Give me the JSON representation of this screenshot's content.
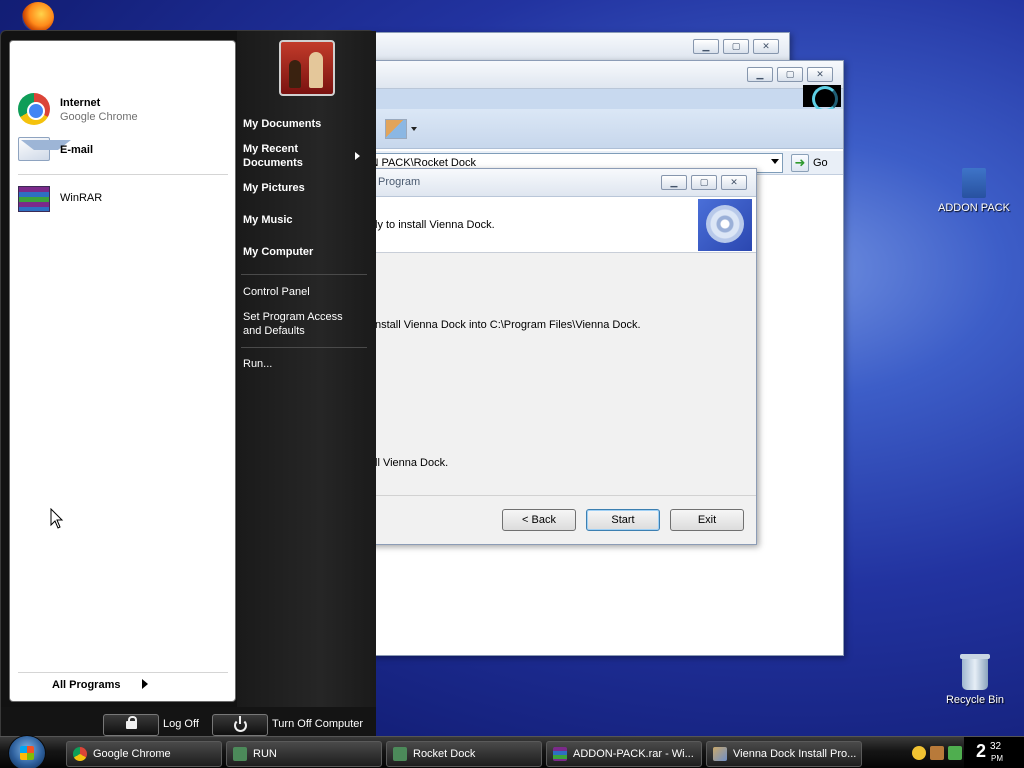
{
  "desktop": {
    "icons": [
      {
        "label": "ADDON PACK"
      },
      {
        "label": "Recycle Bin"
      }
    ]
  },
  "explorer": {
    "address": "DDON PACK\\Rocket Dock",
    "go_label": "Go"
  },
  "installer": {
    "title": "Program",
    "header_text": "ly to install Vienna Dock.",
    "body_text": "nstall Vienna Dock into C:\\Program Files\\Vienna Dock.",
    "body_text_2": "ll Vienna Dock.",
    "buttons": {
      "back": "< Back",
      "start": "Start",
      "exit": "Exit"
    }
  },
  "start_menu": {
    "pinned": [
      {
        "title": "Internet",
        "subtitle": "Google Chrome"
      },
      {
        "title": "E-mail"
      }
    ],
    "recent": [
      {
        "title": "WinRAR"
      }
    ],
    "all_programs": "All Programs",
    "right": {
      "my_documents": "My Documents",
      "my_recent_1": "My Recent",
      "my_recent_2": "Documents",
      "my_pictures": "My Pictures",
      "my_music": "My Music",
      "my_computer": "My Computer",
      "control_panel": "Control Panel",
      "set_program_1": "Set Program Access",
      "set_program_2": "and Defaults",
      "run": "Run..."
    },
    "log_off": "Log Off",
    "turn_off": "Turn Off Computer"
  },
  "taskbar": {
    "items": [
      {
        "label": "Google Chrome",
        "icon": "chrome-icon"
      },
      {
        "label": "RUN",
        "icon": "run-icon"
      },
      {
        "label": "Rocket Dock",
        "icon": "folder-icon"
      },
      {
        "label": "ADDON-PACK.rar - Wi...",
        "icon": "winrar-icon"
      },
      {
        "label": "Vienna Dock Install Pro...",
        "icon": "installer-icon"
      }
    ],
    "clock": {
      "hour": "2",
      "minutes": "32",
      "ampm": "PM"
    }
  }
}
